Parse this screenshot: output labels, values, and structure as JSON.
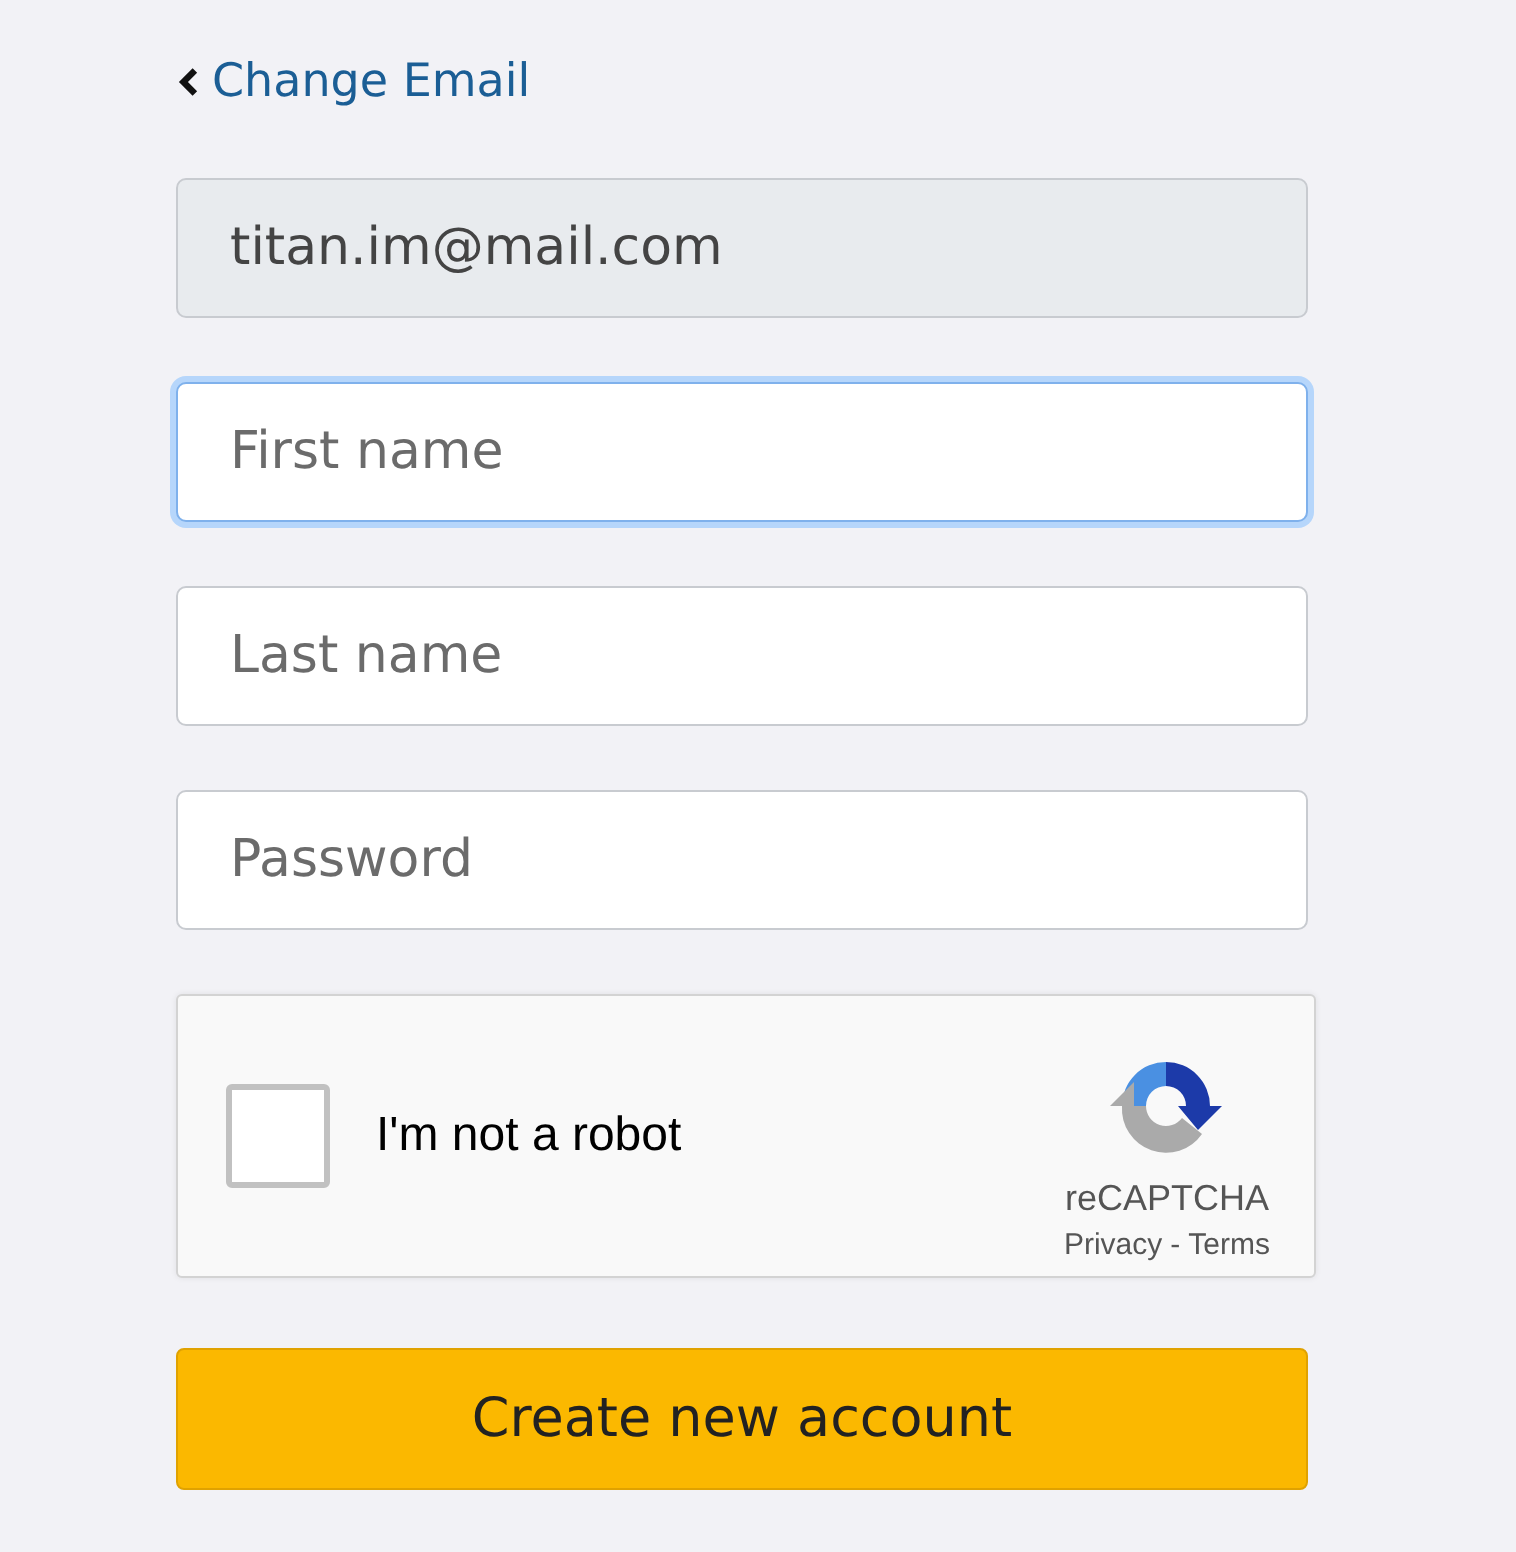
{
  "back_link": {
    "label": "Change Email"
  },
  "fields": [
    {
      "value": "titan.im@mail.com",
      "disabled": true,
      "focused": false
    },
    {
      "placeholder": "First name",
      "disabled": false,
      "focused": true
    },
    {
      "placeholder": "Last name",
      "disabled": false,
      "focused": false
    },
    {
      "placeholder": "Password",
      "disabled": false,
      "focused": false
    }
  ],
  "captcha": {
    "label": "I'm not a robot",
    "checked": false,
    "brand": "reCAPTCHA",
    "privacy": "Privacy",
    "separator": "-",
    "terms": "Terms"
  },
  "submit_button": {
    "label": "Create new account"
  }
}
